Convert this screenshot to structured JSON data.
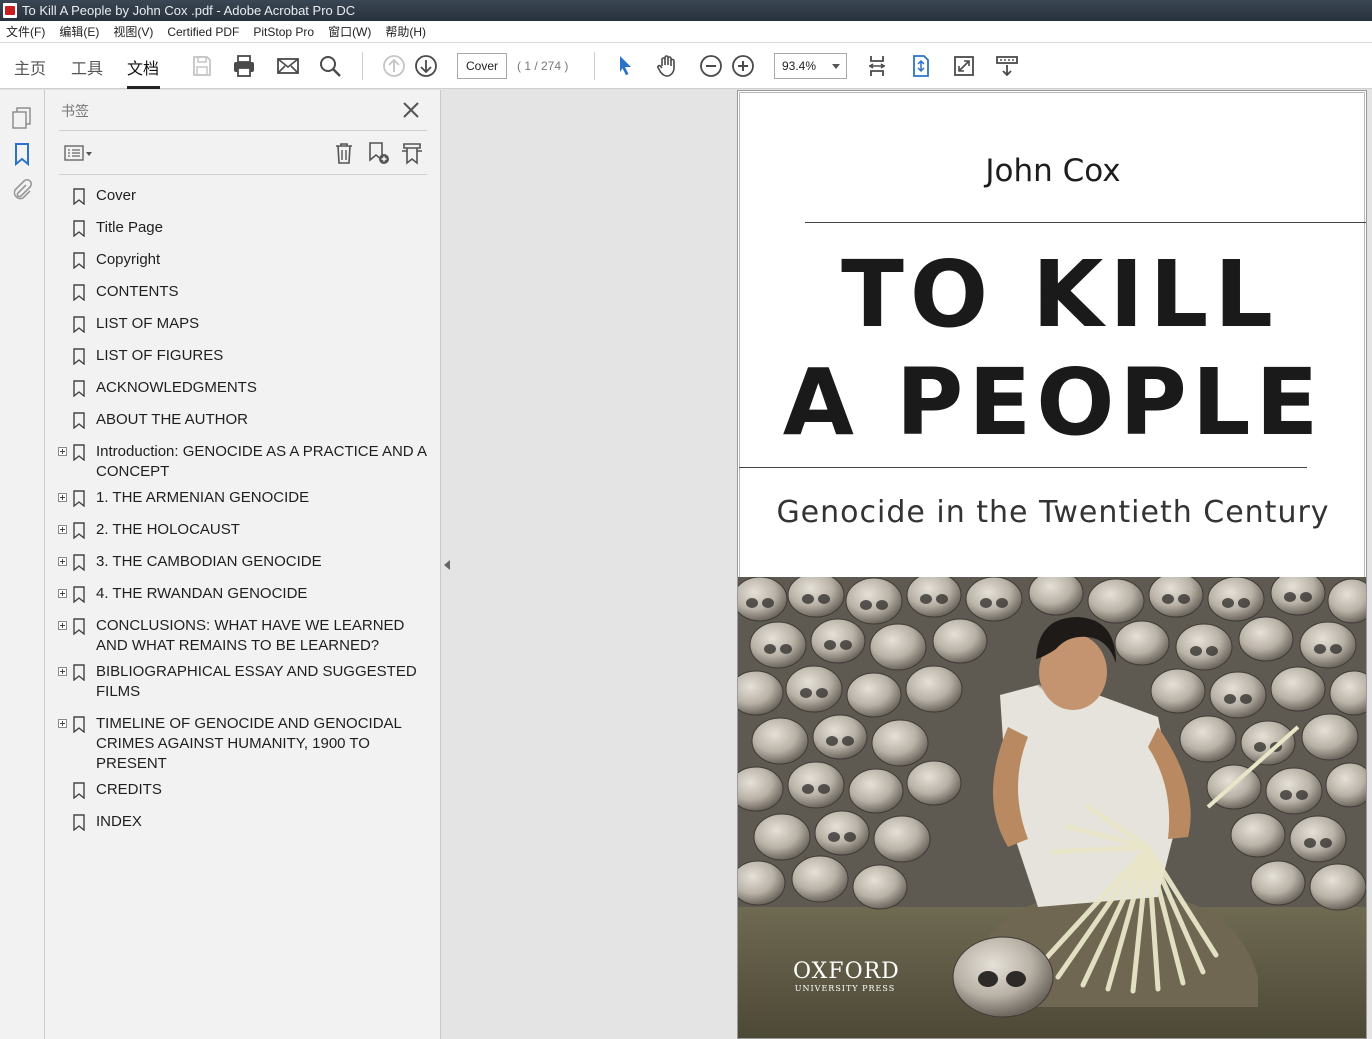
{
  "window": {
    "title": "To Kill A People by John Cox .pdf - Adobe Acrobat Pro DC"
  },
  "menubar": {
    "items": [
      "文件(F)",
      "编辑(E)",
      "视图(V)",
      "Certified PDF",
      "PitStop Pro",
      "窗口(W)",
      "帮助(H)"
    ]
  },
  "toolbar": {
    "tabs": [
      "主页",
      "工具",
      "文档"
    ],
    "active_tab": "文档",
    "page_input": "Cover",
    "page_count": "( 1 / 274 )",
    "zoom": "93.4%",
    "icons": [
      "save-icon",
      "print-icon",
      "email-icon",
      "search-icon",
      "prev-page-icon",
      "next-page-icon",
      "select-cursor-icon",
      "hand-icon",
      "zoom-out-icon",
      "zoom-in-icon",
      "fit-page-icon",
      "scroll-mode-icon",
      "fullscreen-icon",
      "reading-mode-icon"
    ]
  },
  "bookmarks_panel": {
    "title": "书签",
    "items": [
      {
        "label": "Cover",
        "expandable": false
      },
      {
        "label": "Title Page",
        "expandable": false
      },
      {
        "label": "Copyright",
        "expandable": false
      },
      {
        "label": "CONTENTS",
        "expandable": false
      },
      {
        "label": "LIST OF MAPS",
        "expandable": false
      },
      {
        "label": "LIST OF FIGURES",
        "expandable": false
      },
      {
        "label": "ACKNOWLEDGMENTS",
        "expandable": false
      },
      {
        "label": "ABOUT THE AUTHOR",
        "expandable": false
      },
      {
        "label": "Introduction: GENOCIDE AS A PRACTICE AND A CONCEPT",
        "expandable": true
      },
      {
        "label": "1. THE ARMENIAN GENOCIDE",
        "expandable": true
      },
      {
        "label": "2. THE HOLOCAUST",
        "expandable": true
      },
      {
        "label": "3. THE CAMBODIAN GENOCIDE",
        "expandable": true
      },
      {
        "label": "4. THE RWANDAN GENOCIDE",
        "expandable": true
      },
      {
        "label": "CONCLUSIONS: WHAT HAVE WE LEARNED AND WHAT REMAINS TO BE LEARNED?",
        "expandable": true
      },
      {
        "label": "BIBLIOGRAPHICAL ESSAY AND SUGGESTED FILMS",
        "expandable": true
      },
      {
        "label": "TIMELINE OF GENOCIDE AND GENOCIDAL CRIMES AGAINST HUMANITY, 1900 TO PRESENT",
        "expandable": true
      },
      {
        "label": "CREDITS",
        "expandable": false
      },
      {
        "label": "INDEX",
        "expandable": false
      }
    ]
  },
  "document": {
    "author": "John Cox",
    "title_line1": "TO KILL",
    "title_line2": "A PEOPLE",
    "subtitle": "Genocide in the Twentieth Century",
    "publisher": "OXFORD",
    "publisher_sub": "UNIVERSITY PRESS"
  }
}
